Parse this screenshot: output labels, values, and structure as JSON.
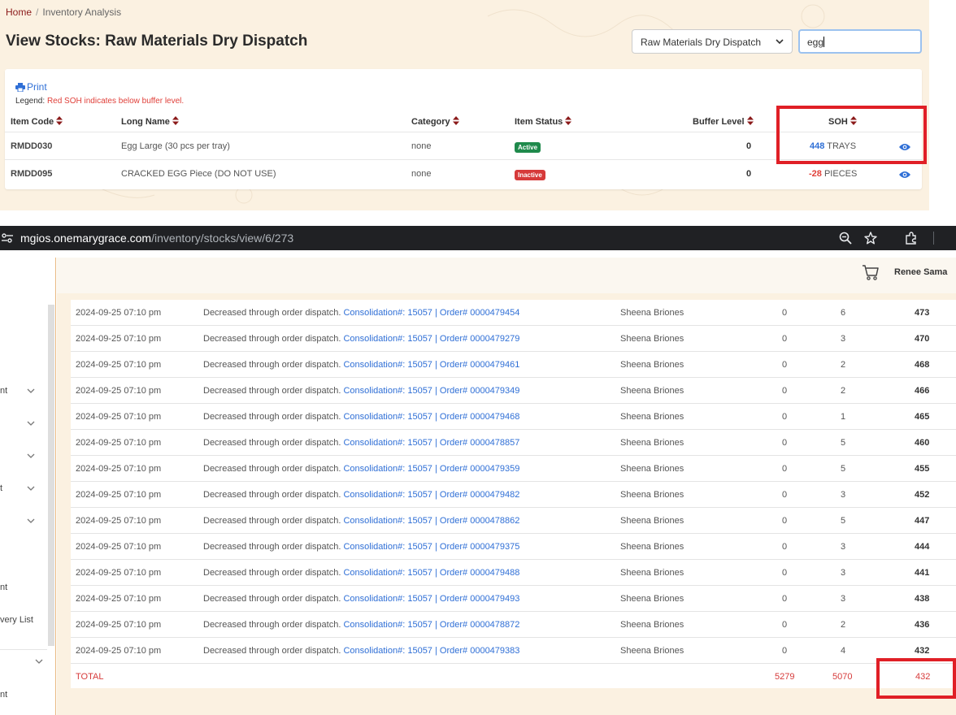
{
  "breadcrumb": {
    "home": "Home",
    "current": "Inventory Analysis"
  },
  "page_title": "View Stocks: Raw Materials Dry Dispatch",
  "location_select": {
    "value": "Raw Materials Dry Dispatch"
  },
  "search": {
    "value": "egg"
  },
  "stock_card": {
    "print_label": "Print",
    "legend_label": "Legend:",
    "legend_text": "Red SOH indicates below buffer level.",
    "columns": {
      "item_code": "Item Code",
      "long_name": "Long Name",
      "category": "Category",
      "item_status": "Item Status",
      "buffer_level": "Buffer Level",
      "soh": "SOH"
    },
    "rows": [
      {
        "item_code": "RMDD030",
        "long_name": "Egg Large (30 pcs per tray)",
        "category": "none",
        "status": "Active",
        "buffer": "0",
        "soh": "448",
        "unit": "TRAYS"
      },
      {
        "item_code": "RMDD095",
        "long_name": "CRACKED EGG Piece (DO NOT USE)",
        "category": "none",
        "status": "Inactive",
        "buffer": "0",
        "soh": "-28",
        "unit": "PIECES"
      }
    ]
  },
  "browser": {
    "url_host": "mgios.onemarygrace.com",
    "url_path": "/inventory/stocks/view/6/273"
  },
  "topbar": {
    "user_name": "Renee Sama"
  },
  "sidebar": {
    "items": [
      "nt",
      "t",
      "nt",
      "very List",
      "nt"
    ]
  },
  "ledger": {
    "rows": [
      {
        "date": "2024-09-25 07:10 pm",
        "desc": "Decreased through order dispatch.",
        "consolidation": "Consolidation#: 15057",
        "sep": "|",
        "order": "Order# 0000479454",
        "user": "Sheena Briones",
        "in": "0",
        "out": "6",
        "balance": "473"
      },
      {
        "date": "2024-09-25 07:10 pm",
        "desc": "Decreased through order dispatch.",
        "consolidation": "Consolidation#: 15057",
        "sep": "|",
        "order": "Order# 0000479279",
        "user": "Sheena Briones",
        "in": "0",
        "out": "3",
        "balance": "470"
      },
      {
        "date": "2024-09-25 07:10 pm",
        "desc": "Decreased through order dispatch.",
        "consolidation": "Consolidation#: 15057",
        "sep": "|",
        "order": "Order# 0000479461",
        "user": "Sheena Briones",
        "in": "0",
        "out": "2",
        "balance": "468"
      },
      {
        "date": "2024-09-25 07:10 pm",
        "desc": "Decreased through order dispatch.",
        "consolidation": "Consolidation#: 15057",
        "sep": "|",
        "order": "Order# 0000479349",
        "user": "Sheena Briones",
        "in": "0",
        "out": "2",
        "balance": "466"
      },
      {
        "date": "2024-09-25 07:10 pm",
        "desc": "Decreased through order dispatch.",
        "consolidation": "Consolidation#: 15057",
        "sep": "|",
        "order": "Order# 0000479468",
        "user": "Sheena Briones",
        "in": "0",
        "out": "1",
        "balance": "465"
      },
      {
        "date": "2024-09-25 07:10 pm",
        "desc": "Decreased through order dispatch.",
        "consolidation": "Consolidation#: 15057",
        "sep": "|",
        "order": "Order# 0000478857",
        "user": "Sheena Briones",
        "in": "0",
        "out": "5",
        "balance": "460"
      },
      {
        "date": "2024-09-25 07:10 pm",
        "desc": "Decreased through order dispatch.",
        "consolidation": "Consolidation#: 15057",
        "sep": "|",
        "order": "Order# 0000479359",
        "user": "Sheena Briones",
        "in": "0",
        "out": "5",
        "balance": "455"
      },
      {
        "date": "2024-09-25 07:10 pm",
        "desc": "Decreased through order dispatch.",
        "consolidation": "Consolidation#: 15057",
        "sep": "|",
        "order": "Order# 0000479482",
        "user": "Sheena Briones",
        "in": "0",
        "out": "3",
        "balance": "452"
      },
      {
        "date": "2024-09-25 07:10 pm",
        "desc": "Decreased through order dispatch.",
        "consolidation": "Consolidation#: 15057",
        "sep": "|",
        "order": "Order# 0000478862",
        "user": "Sheena Briones",
        "in": "0",
        "out": "5",
        "balance": "447"
      },
      {
        "date": "2024-09-25 07:10 pm",
        "desc": "Decreased through order dispatch.",
        "consolidation": "Consolidation#: 15057",
        "sep": "|",
        "order": "Order# 0000479375",
        "user": "Sheena Briones",
        "in": "0",
        "out": "3",
        "balance": "444"
      },
      {
        "date": "2024-09-25 07:10 pm",
        "desc": "Decreased through order dispatch.",
        "consolidation": "Consolidation#: 15057",
        "sep": "|",
        "order": "Order# 0000479488",
        "user": "Sheena Briones",
        "in": "0",
        "out": "3",
        "balance": "441"
      },
      {
        "date": "2024-09-25 07:10 pm",
        "desc": "Decreased through order dispatch.",
        "consolidation": "Consolidation#: 15057",
        "sep": "|",
        "order": "Order# 0000479493",
        "user": "Sheena Briones",
        "in": "0",
        "out": "3",
        "balance": "438"
      },
      {
        "date": "2024-09-25 07:10 pm",
        "desc": "Decreased through order dispatch.",
        "consolidation": "Consolidation#: 15057",
        "sep": "|",
        "order": "Order# 0000478872",
        "user": "Sheena Briones",
        "in": "0",
        "out": "2",
        "balance": "436"
      },
      {
        "date": "2024-09-25 07:10 pm",
        "desc": "Decreased through order dispatch.",
        "consolidation": "Consolidation#: 15057",
        "sep": "|",
        "order": "Order# 0000479383",
        "user": "Sheena Briones",
        "in": "0",
        "out": "4",
        "balance": "432"
      }
    ],
    "total": {
      "label": "TOTAL",
      "in": "5279",
      "out": "5070",
      "balance": "432"
    }
  },
  "colors": {
    "brand_red": "#8b1a1a",
    "link_blue": "#2f6fd6",
    "alert_red": "#e0403a",
    "highlight_box": "#e01f26",
    "panel_cream": "#fbf1e1"
  },
  "icons": [
    "print-icon",
    "chevron-down-icon",
    "sort-icon",
    "eye-icon",
    "tune-icon",
    "zoom-icon",
    "star-icon",
    "extension-icon",
    "cart-icon"
  ]
}
